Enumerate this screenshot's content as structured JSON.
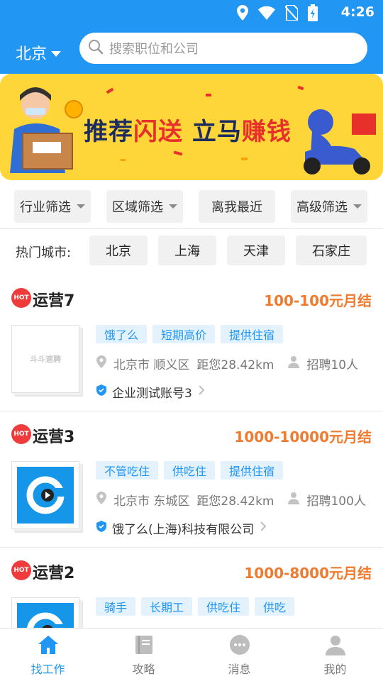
{
  "status_bar": {
    "time": "4:26",
    "icons": [
      "location-icon",
      "wifi-icon",
      "no-sim-icon",
      "battery-icon"
    ]
  },
  "header": {
    "city": "北京",
    "search_placeholder": "搜索职位和公司"
  },
  "banner": {
    "text_dark_1": "推荐",
    "text_red_1": "闪送",
    "text_dark_2": " 立马",
    "text_red_2": "赚钱"
  },
  "filters": [
    "行业筛选",
    "区域筛选",
    "离我最近",
    "高级筛选"
  ],
  "hot_cities": {
    "label": "热门城市:",
    "cities": [
      "北京",
      "上海",
      "天津",
      "石家庄"
    ]
  },
  "jobs": [
    {
      "badge": "HOT",
      "title": "运营7",
      "salary": "100-100元月结",
      "tags": [
        "饿了么",
        "短期高价",
        "提供住宿"
      ],
      "location": "北京市 顺义区",
      "distance": "距您28.42km",
      "hiring": "招聘10人",
      "company": "企业测试账号3",
      "logo_text": "斗斗速聘"
    },
    {
      "badge": "HOT",
      "title": "运营3",
      "salary": "1000-10000元月结",
      "tags": [
        "不管吃住",
        "供吃住",
        "提供住宿"
      ],
      "location": "北京市 东城区",
      "distance": "距您28.42km",
      "hiring": "招聘100人",
      "company": "饿了么(上海)科技有限公司"
    },
    {
      "badge": "HOT",
      "title": "运营2",
      "salary": "1000-8000元月结",
      "tags": [
        "骑手",
        "长期工",
        "供吃住",
        "供吃"
      ]
    }
  ],
  "bottom_nav": [
    {
      "label": "找工作",
      "icon": "home-icon",
      "active": true
    },
    {
      "label": "攻略",
      "icon": "book-icon",
      "active": false
    },
    {
      "label": "消息",
      "icon": "message-icon",
      "active": false
    },
    {
      "label": "我的",
      "icon": "profile-icon",
      "active": false
    }
  ],
  "colors": {
    "primary": "#2196f3",
    "salary": "#f07b2e",
    "hot": "#ef3b3b",
    "banner": "#ffd63a"
  }
}
